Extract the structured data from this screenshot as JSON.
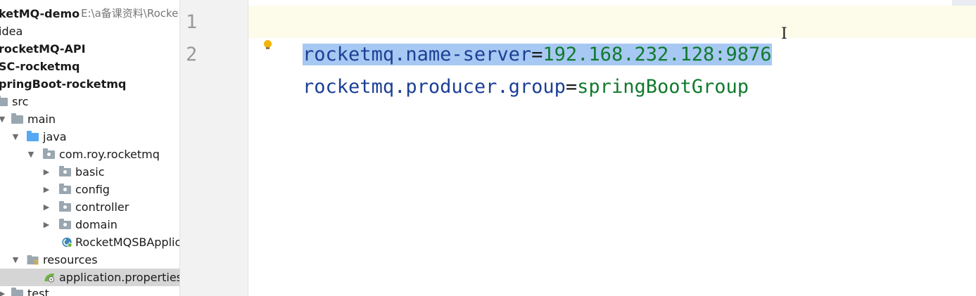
{
  "tree": {
    "rows": [
      {
        "label": "ketMQ-demo",
        "bold": true,
        "path": "E:\\a备课资料\\Rocke"
      },
      {
        "label": "idea"
      },
      {
        "label": "rocketMQ-API",
        "bold": true
      },
      {
        "label": "SC-rocketmq",
        "bold": true
      },
      {
        "label": "pringBoot-rocketmq",
        "bold": true
      },
      {
        "label": "src"
      },
      {
        "label": "main"
      },
      {
        "label": "java"
      },
      {
        "label": "com.roy.rocketmq"
      },
      {
        "label": "basic"
      },
      {
        "label": "config"
      },
      {
        "label": "controller"
      },
      {
        "label": "domain"
      },
      {
        "label": "RocketMQSBApplica"
      },
      {
        "label": "resources"
      },
      {
        "label": "application.properties"
      },
      {
        "label": "test"
      }
    ]
  },
  "editor": {
    "line_numbers": [
      "1",
      "2"
    ],
    "lines": [
      {
        "key": "rocketmq.name-server",
        "eq": "=",
        "value": "192.168.232.128:9876"
      },
      {
        "key": "rocketmq.producer.group",
        "eq": "=",
        "value": "springBootGroup"
      }
    ]
  },
  "colors": {
    "key": "#1c3f95",
    "value": "#117a2d",
    "selection": "#a6c8f2",
    "selected_row": "#d5d5d5"
  }
}
